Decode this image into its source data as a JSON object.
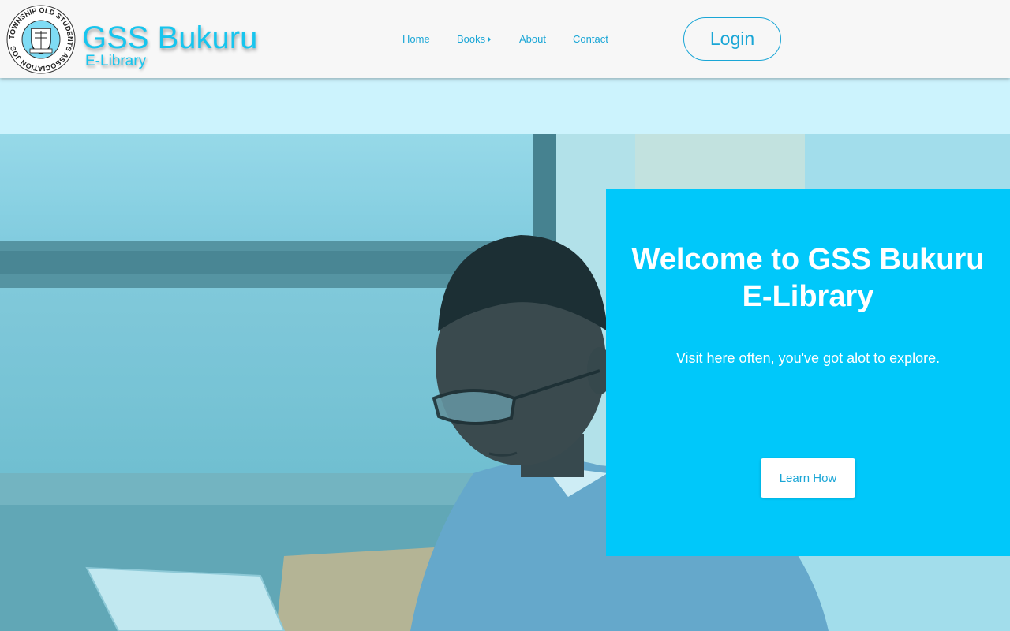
{
  "header": {
    "logo_alt": "Township Old Students Association Jos logo",
    "logo_ring_text": "TOWNSHIP OLD STUDENTS ASSOCIATION JOS",
    "brand_title": "GSS Bukuru",
    "brand_subtitle": "E-Library",
    "login_label": "Login"
  },
  "nav": {
    "items": [
      {
        "label": "Home"
      },
      {
        "label": "Books",
        "has_submenu": true,
        "icon": "caret-right-icon"
      },
      {
        "label": "About"
      },
      {
        "label": "Contact"
      }
    ]
  },
  "hero": {
    "image": "student-reading-at-laptop-photo"
  },
  "welcome": {
    "title_line1": "Welcome to GSS Bukuru",
    "title_line2": "E-Library",
    "text": "Visit here often, you've got alot to explore.",
    "button_label": "Learn How"
  },
  "colors": {
    "brand": "#17c5ee",
    "nav_text": "#1aa6d6",
    "panel_bg": "#00c8fa",
    "page_bg": "#ccf3fd",
    "header_bg": "#f7f7f7"
  }
}
